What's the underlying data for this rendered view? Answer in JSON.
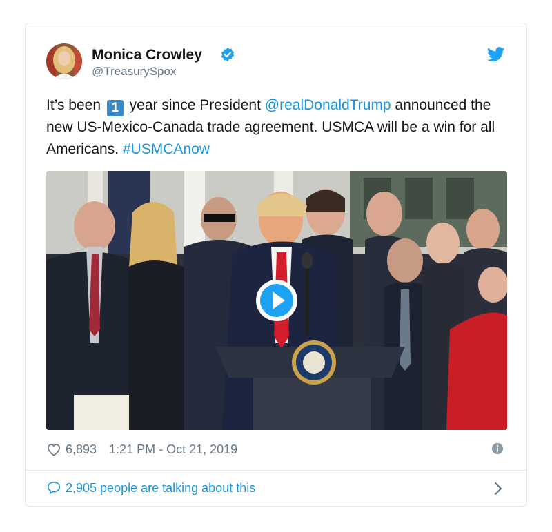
{
  "tweet": {
    "author_name": "Monica Crowley",
    "author_handle": "@TreasurySpox",
    "text_part1": "It’s been ",
    "emoji_number": "1",
    "text_part2": " year since President ",
    "mention": "@realDonaldTrump",
    "text_part3": " announced the new US-Mexico-Canada trade agreement. USMCA will be a win for all Americans. ",
    "hashtag": "#USMCAnow",
    "likes": "6,893",
    "timestamp": "1:21 PM - Oct 21, 2019",
    "talking": "2,905 people are talking about this"
  },
  "icons": {
    "verified": "verified-badge-icon",
    "brand": "twitter-bird-icon",
    "like": "heart-icon",
    "info": "info-icon",
    "reply": "speech-bubble-icon",
    "more": "chevron-right-icon",
    "media_play": "play-icon"
  },
  "colors": {
    "link": "#1b95e0",
    "muted": "#657786",
    "border": "#e1e8ed"
  }
}
